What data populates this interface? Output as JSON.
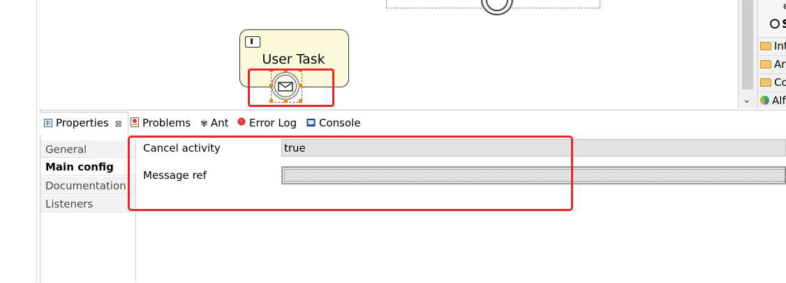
{
  "diagram": {
    "user_task_label": "User Task"
  },
  "palette": {
    "partial_char": "e",
    "partial_heading": "S",
    "items": [
      {
        "label": "Int",
        "icon": "folder-icon"
      },
      {
        "label": "Ar",
        "icon": "folder-icon"
      },
      {
        "label": "Co",
        "icon": "folder-icon"
      },
      {
        "label": "Alf",
        "icon": "alfresco-icon"
      }
    ]
  },
  "tabs": [
    {
      "label": "Properties",
      "icon": "properties-icon"
    },
    {
      "label": "Problems",
      "icon": "problems-icon"
    },
    {
      "label": "Ant",
      "icon": "ant-icon"
    },
    {
      "label": "Error Log",
      "icon": "error-log-icon"
    },
    {
      "label": "Console",
      "icon": "console-icon"
    }
  ],
  "tab_close_glyph": "⊠",
  "sidenav": {
    "items": [
      "General",
      "Main config",
      "Documentation",
      "Listeners"
    ],
    "active": "Main config"
  },
  "form": {
    "cancel_activity_label": "Cancel activity",
    "cancel_activity_value": "true",
    "message_ref_label": "Message ref",
    "message_ref_value": ""
  },
  "colors": {
    "highlight_red": "#e8262a",
    "task_fill": "#fbfbdc",
    "handle_orange": "#f48000"
  }
}
